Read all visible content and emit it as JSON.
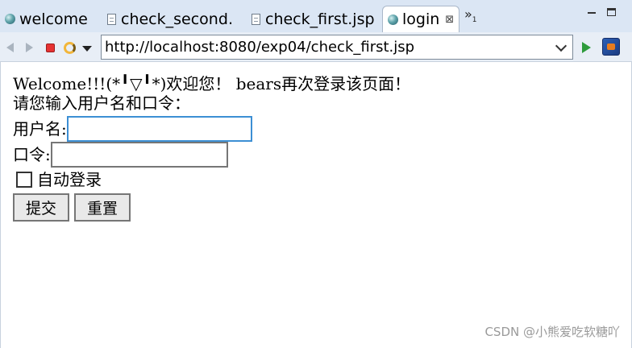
{
  "tabs": [
    {
      "label": "welcome",
      "icon": "globe-icon",
      "active": false
    },
    {
      "label": "check_second…",
      "icon": "page-icon",
      "active": false
    },
    {
      "label": "check_first.jsp",
      "icon": "page-icon",
      "active": false
    },
    {
      "label": "login",
      "icon": "globe-icon",
      "active": true,
      "close": "⊠"
    }
  ],
  "tab_overflow": {
    "glyph": "»",
    "count": "1"
  },
  "toolbar": {
    "url": "http://localhost:8080/exp04/check_first.jsp"
  },
  "page": {
    "welcome_text": "Welcome!!!(*╹▽╹*)欢迎您！ bears再次登录该页面！",
    "prompt_text": "请您输入用户名和口令：",
    "username_label": "用户名:",
    "username_value": "",
    "password_label": "口令:",
    "password_value": "",
    "auto_login_label": "自动登录",
    "auto_login_checked": false,
    "submit_label": "提交",
    "reset_label": "重置"
  },
  "watermark": "CSDN @小熊爱吃软糖吖",
  "colors": {
    "tabbar_bg": "#dbe6f4",
    "toolbar_bg": "#e8eef6",
    "focus_border": "#3c8fd4",
    "stop_red": "#e63232",
    "go_green": "#2e9b3c"
  }
}
